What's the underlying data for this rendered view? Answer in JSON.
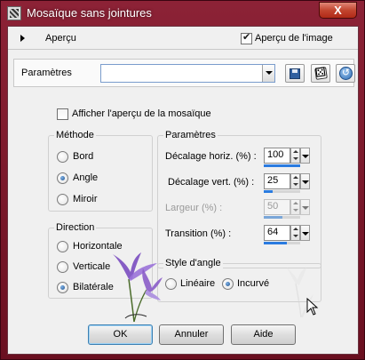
{
  "window": {
    "title": "Mosaïque sans jointures",
    "close_label": "X"
  },
  "preview": {
    "toggle_label": "Aperçu",
    "show_image_label": "Aperçu de l'image",
    "show_image_checked": true
  },
  "presets": {
    "label": "Paramètres",
    "value": ""
  },
  "show_mosaic": {
    "label": "Afficher l'aperçu de la mosaïque",
    "checked": false
  },
  "method": {
    "title": "Méthode",
    "options": [
      {
        "label": "Bord",
        "selected": false
      },
      {
        "label": "Angle",
        "selected": true
      },
      {
        "label": "Miroir",
        "selected": false
      }
    ]
  },
  "direction": {
    "title": "Direction",
    "options": [
      {
        "label": "Horizontale",
        "selected": false
      },
      {
        "label": "Verticale",
        "selected": false
      },
      {
        "label": "Bilatérale",
        "selected": true
      }
    ]
  },
  "params": {
    "title": "Paramètres",
    "fields": [
      {
        "label": "Décalage horiz. (%) :",
        "value": "100",
        "level": 1.0,
        "enabled": true
      },
      {
        "label": "Décalage vert. (%) :",
        "value": "25",
        "level": 0.25,
        "enabled": true
      },
      {
        "label": "Largeur (%) :",
        "value": "50",
        "level": 0.5,
        "enabled": false
      },
      {
        "label": "Transition (%) :",
        "value": "64",
        "level": 0.64,
        "enabled": true
      }
    ]
  },
  "corner_style": {
    "title": "Style d'angle",
    "options": [
      {
        "label": "Linéaire",
        "selected": false
      },
      {
        "label": "Incurvé",
        "selected": true
      }
    ]
  },
  "buttons": {
    "ok": "OK",
    "cancel": "Annuler",
    "help": "Aide"
  },
  "colors": {
    "frame": "#7a1628",
    "accent": "#2a7be0",
    "flower": "#8a5cc8"
  }
}
